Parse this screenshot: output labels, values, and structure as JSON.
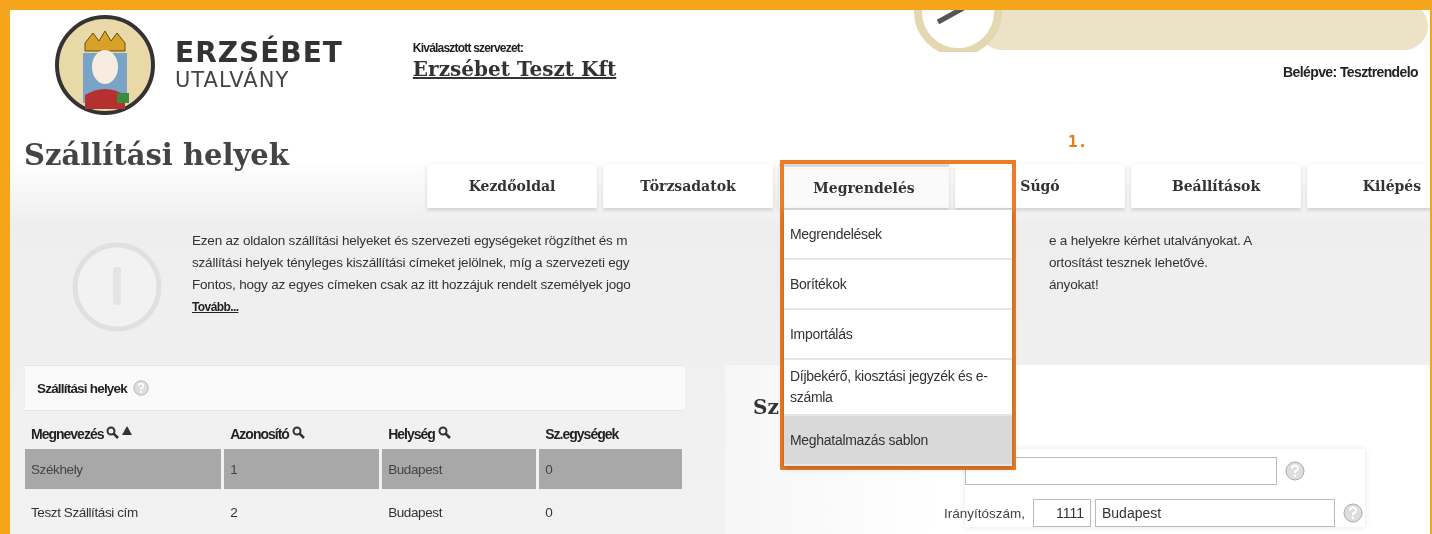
{
  "header": {
    "logo_line1": "ERZSÉBET",
    "logo_line2": "UTALVÁNY",
    "org_label": "Kiválasztott szervezet:",
    "org_name": "Erzsébet Teszt Kft",
    "login": "Belépve: Tesztrendelo"
  },
  "page_title": "Szállítási helyek",
  "tabs": [
    {
      "label": "Kezdőoldal",
      "selected": false
    },
    {
      "label": "Törzsadatok",
      "selected": false
    },
    {
      "label": "Megrendelés",
      "selected": true
    },
    {
      "label": "Súgó",
      "selected": false
    },
    {
      "label": "Beállítások",
      "selected": false
    },
    {
      "label": "Kilépés",
      "selected": false
    }
  ],
  "annotation": {
    "label": "1."
  },
  "dropdown": {
    "items": [
      {
        "label": "Megrendelések",
        "selected": false
      },
      {
        "label": "Borítékok",
        "selected": false
      },
      {
        "label": "Importálás",
        "selected": false
      },
      {
        "label": "Díjbekérő, kiosztási jegyzék és e-számla",
        "selected": false
      },
      {
        "label": "Meghatalmazás sablon",
        "selected": true
      }
    ]
  },
  "info": {
    "lines": [
      {
        "left": "Ezen az oldalon szállítási helyeket és szervezeti egységeket rögzíthet és m",
        "right": "e a helyekre kérhet utalványokat. A"
      },
      {
        "left": "szállítási helyek tényleges kiszállítási címeket jelölnek, míg a szervezeti egy",
        "right": "ortosítást tesznek lehetővé."
      },
      {
        "left": "Fontos, hogy az egyes címeken csak az itt hozzájuk rendelt személyek jogo",
        "right": "ányokat!"
      }
    ],
    "more_link": "Tovább..."
  },
  "places_table": {
    "title": "Szállítási helyek",
    "columns": [
      {
        "label": "Megnevezés",
        "searchable": true,
        "sorted_ascending": true
      },
      {
        "label": "Azonosító",
        "searchable": true,
        "sorted_ascending": false
      },
      {
        "label": "Helység",
        "searchable": true,
        "sorted_ascending": false
      },
      {
        "label": "Sz.egységek",
        "searchable": false,
        "sorted_ascending": false
      }
    ],
    "rows": [
      {
        "cells": [
          "Székhely",
          "1",
          "Budapest",
          "0"
        ],
        "selected": true
      },
      {
        "cells": [
          "Teszt Szállítási cím",
          "2",
          "Budapest",
          "0"
        ],
        "selected": false
      }
    ]
  },
  "detail": {
    "heading": "Sz",
    "zip_label": "Irányítószám,",
    "zip": "1111",
    "city": "Budapest"
  }
}
